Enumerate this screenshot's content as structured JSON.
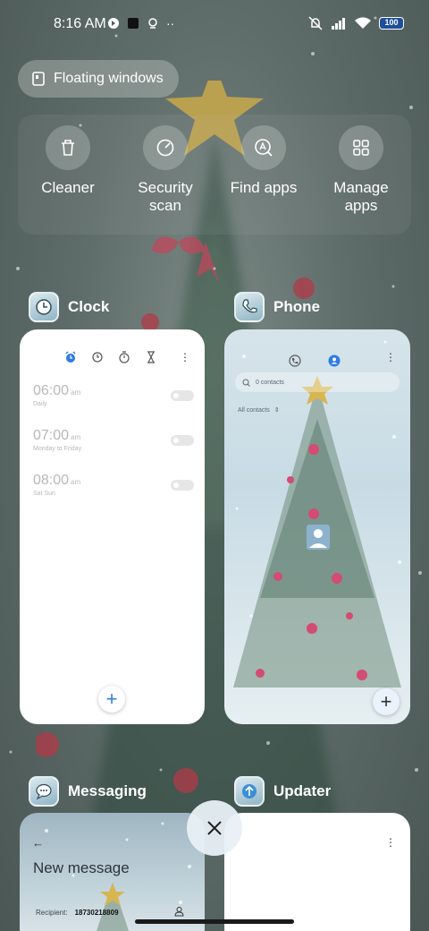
{
  "status": {
    "time": "8:16 AM",
    "battery": "100"
  },
  "floating_windows": {
    "label": "Floating windows"
  },
  "quick_actions": [
    {
      "label": "Cleaner",
      "icon": "trash-icon"
    },
    {
      "label": "Security scan",
      "icon": "security-scan-icon"
    },
    {
      "label": "Find apps",
      "icon": "find-apps-icon"
    },
    {
      "label": "Manage apps",
      "icon": "grid-icon"
    }
  ],
  "apps": {
    "clock": {
      "name": "Clock",
      "alarms": [
        {
          "time": "06:00",
          "ampm": "am",
          "repeat": "Daily"
        },
        {
          "time": "07:00",
          "ampm": "am",
          "repeat": "Monday to Friday"
        },
        {
          "time": "08:00",
          "ampm": "am",
          "repeat": "Sat Sun"
        }
      ],
      "fab": "+"
    },
    "phone": {
      "name": "Phone",
      "search_placeholder": "0 contacts",
      "filter": "All contacts",
      "fab": "+"
    },
    "messaging": {
      "name": "Messaging",
      "title": "New message",
      "recipient_label": "Recipient:",
      "recipient_value": "18730218809"
    },
    "updater": {
      "name": "Updater"
    }
  },
  "colors": {
    "accent": "#2f7be3",
    "battery": "#1e4f9c"
  }
}
